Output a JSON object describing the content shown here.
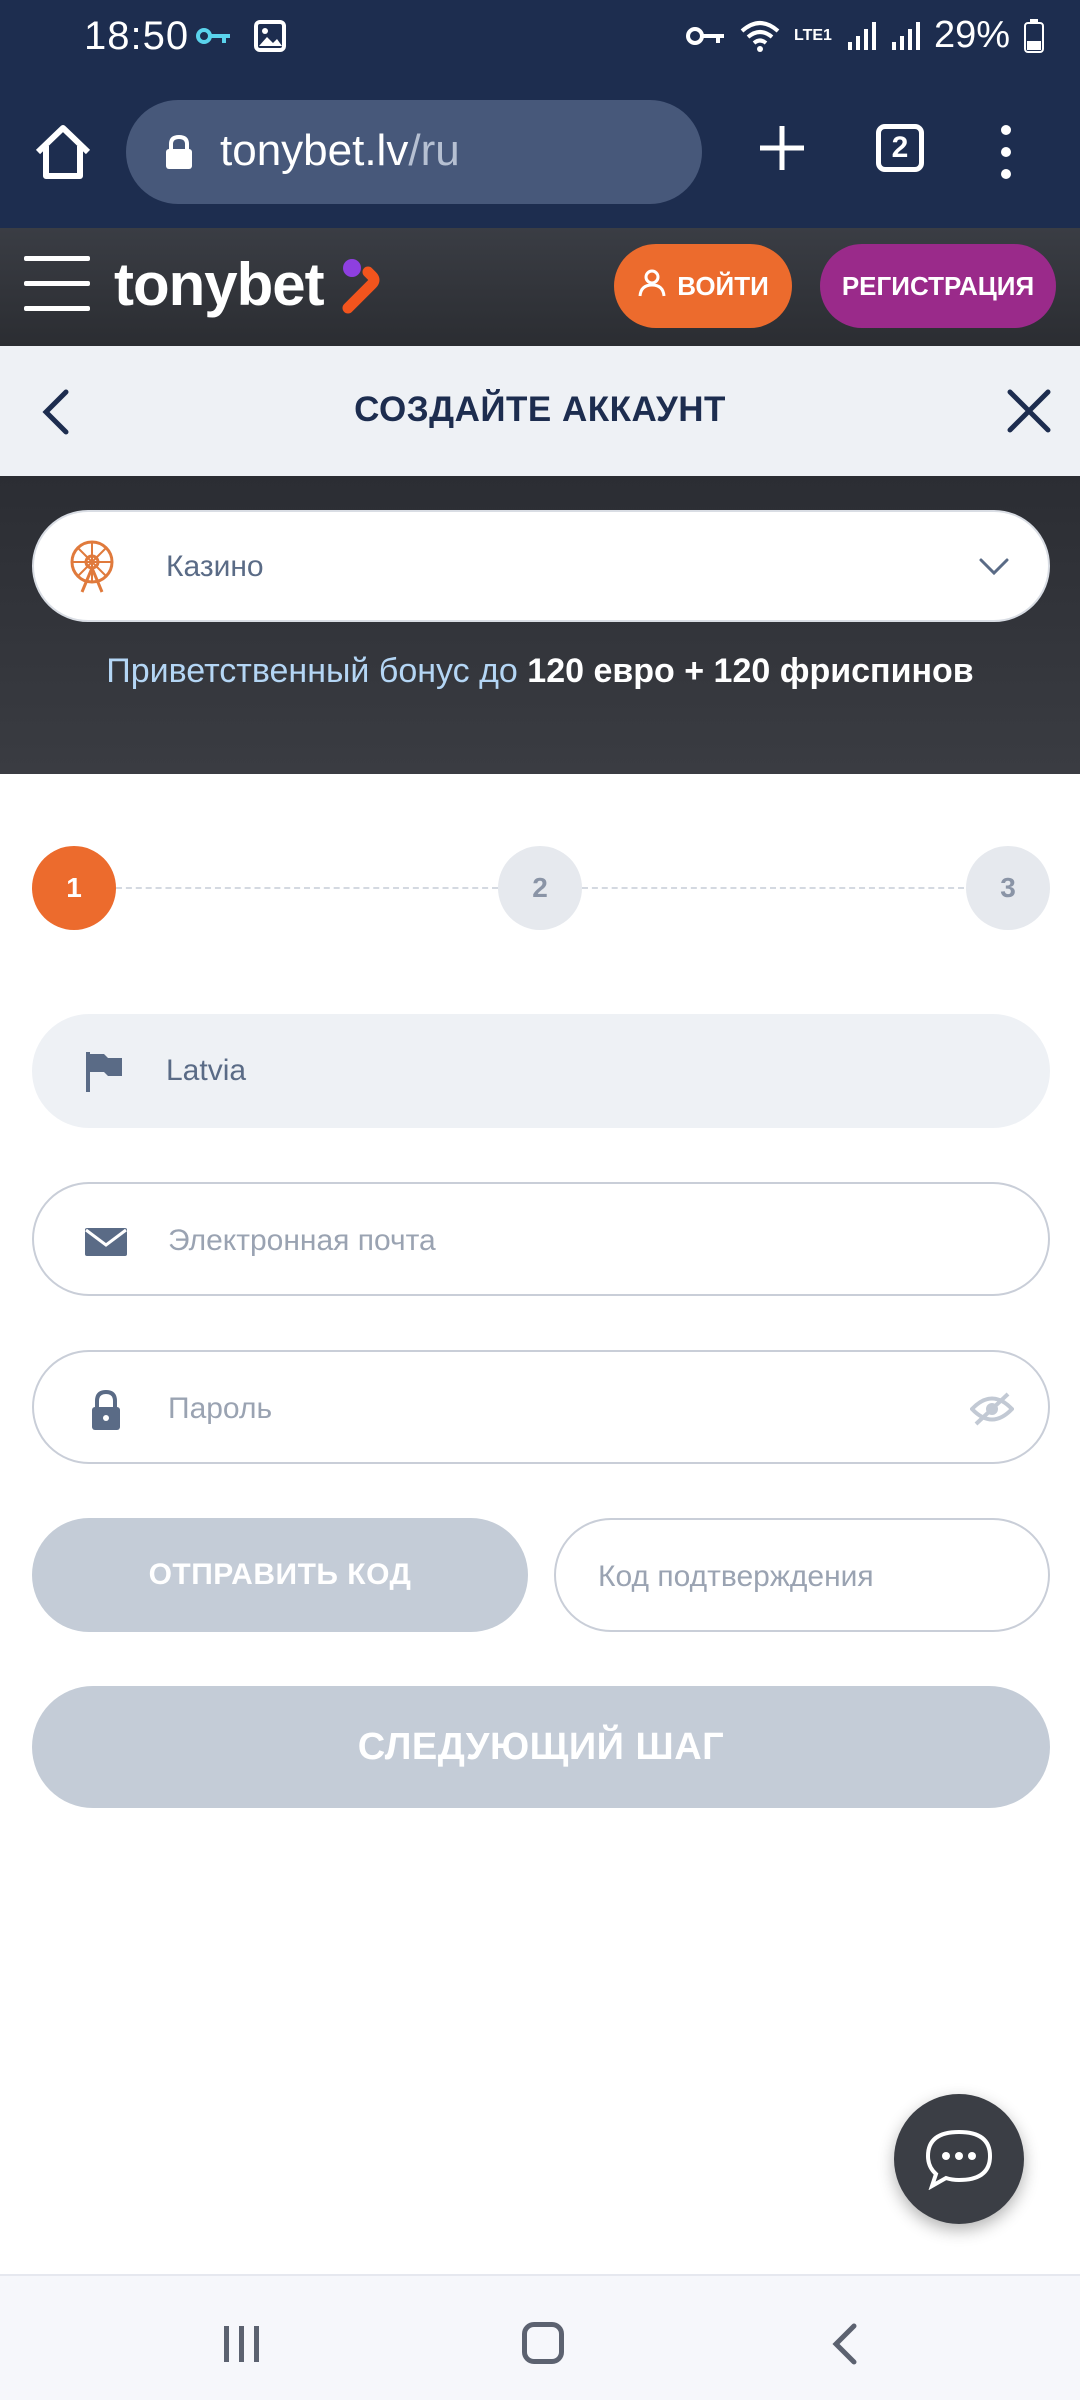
{
  "status_bar": {
    "time": "18:50",
    "battery": "29%",
    "network": "LTE1"
  },
  "browser": {
    "url_domain": "tonybet.lv",
    "url_path": "/ru",
    "tab_count": "2"
  },
  "site_header": {
    "logo": "tonybet",
    "login_label": "ВОЙТИ",
    "register_label": "РЕГИСТРАЦИЯ",
    "colors": {
      "login": "#ec6b2d",
      "register": "#9a2a8a"
    }
  },
  "titlebar": {
    "title": "СОЗДАЙТЕ АККАУНТ"
  },
  "bonus": {
    "selected_product": "Казино",
    "text_prefix": "Приветственный бонус до ",
    "text_bold": "120 евро + 120 фриспинов"
  },
  "stepper": {
    "steps": [
      "1",
      "2",
      "3"
    ],
    "current": 1,
    "active_color": "#ec6b2d"
  },
  "form": {
    "country_value": "Latvia",
    "email_placeholder": "Электронная почта",
    "password_placeholder": "Пароль",
    "send_code_label": "ОТПРАВИТЬ КОД",
    "code_placeholder": "Код подтверждения",
    "next_step_label": "СЛЕДУЮЩИЙ ШАГ"
  },
  "icons": {
    "country": "flag-icon",
    "email": "envelope-icon",
    "password": "lock-icon",
    "toggle_password": "eye-off-icon",
    "chat": "chat-bubble-icon"
  }
}
